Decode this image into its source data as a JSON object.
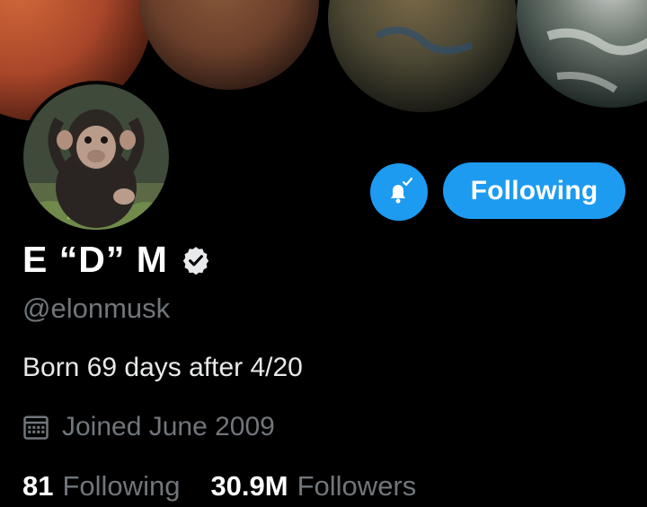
{
  "profile": {
    "display_name": "E “D” M",
    "handle": "@elonmusk",
    "bio": "Born 69 days after 4/20",
    "joined": "Joined June 2009",
    "verified": true
  },
  "actions": {
    "follow_label": "Following",
    "notify_icon": "bell-check-icon"
  },
  "stats": {
    "following_count": "81",
    "following_label": "Following",
    "followers_count": "30.9M",
    "followers_label": "Followers"
  },
  "colors": {
    "accent": "#1d9bf0",
    "background": "#000000",
    "muted_text": "#71767b"
  }
}
